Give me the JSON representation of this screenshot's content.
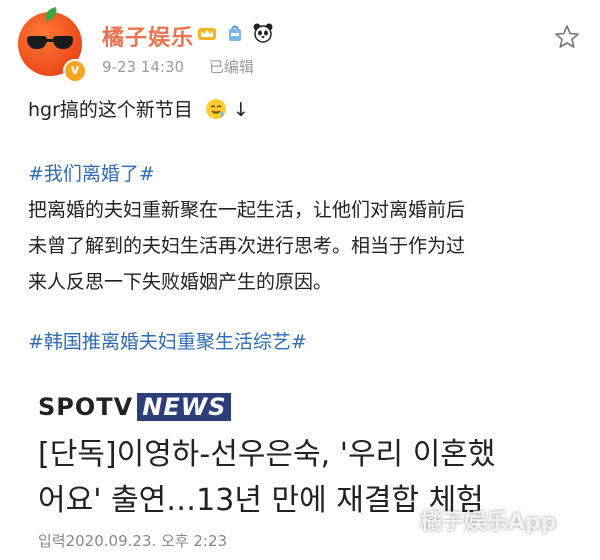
{
  "header": {
    "username": "橘子娱乐",
    "timestamp": "9-23 14:30",
    "edited_label": "已编辑",
    "badges": [
      "crown-badge",
      "bag-badge",
      "panda-badge"
    ],
    "verified_mark": "v"
  },
  "post": {
    "intro": "hgr搞的这个新节目",
    "hashtag1": "#我们离婚了#",
    "body_line1": "把离婚的夫妇重新聚在一起生活，让他们对离婚前后",
    "body_line2": "未曾了解到的夫妇生活再次进行思考。相当于作为过",
    "body_line3": "来人反思一下失败婚姻产生的原因。",
    "hashtag2": "#韩国推离婚夫妇重聚生活综艺#"
  },
  "news": {
    "logo_left": "SPOTV",
    "logo_right": "NEWS",
    "headline_line1": "[단독]이영하-선우은숙, '우리 이혼했",
    "headline_line2": "어요' 출연…13년 만에 재결합 체험",
    "dateline": "입력2020.09.23. 오후 2:23",
    "watermark": "橘子娱乐App"
  },
  "colors": {
    "username": "#eb7350",
    "hashtag": "#2f6bb7",
    "meta": "#9a9a9a"
  }
}
